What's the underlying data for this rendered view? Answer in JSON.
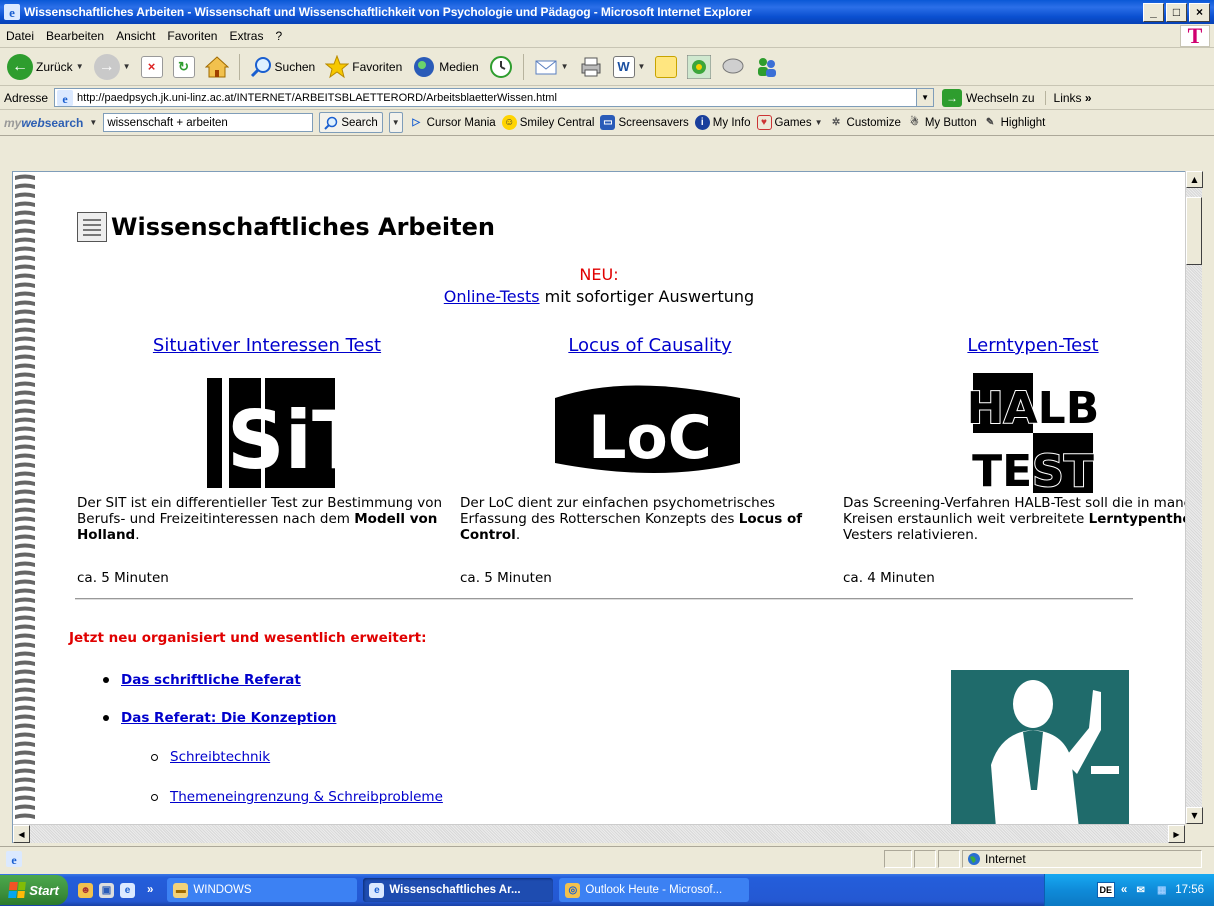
{
  "window": {
    "title": "Wissenschaftliches Arbeiten - Wissenschaft und Wissenschaftlichkeit von Psychologie und Pädagog - Microsoft Internet Explorer",
    "min": "_",
    "max": "□",
    "close": "×"
  },
  "menu": {
    "items": [
      "Datei",
      "Bearbeiten",
      "Ansicht",
      "Favoriten",
      "Extras",
      "?"
    ],
    "brand": "T"
  },
  "toolbar": {
    "back": "Zurück",
    "search": "Suchen",
    "favorites": "Favoriten",
    "media": "Medien"
  },
  "address": {
    "label": "Adresse",
    "url": "http://paedpsych.jk.uni-linz.ac.at/INTERNET/ARBEITSBLAETTERORD/ArbeitsblaetterWissen.html",
    "go": "Wechseln zu",
    "links": "Links"
  },
  "searchbar": {
    "brand_my": "my",
    "brand_web": "web",
    "brand_search": "search",
    "query": "wissenschaft + arbeiten",
    "button": "Search",
    "items": [
      "Cursor Mania",
      "Smiley Central",
      "Screensavers",
      "My Info",
      "Games",
      "Customize",
      "My Button",
      "Highlight"
    ]
  },
  "page": {
    "title": "Wissenschaftliches Arbeiten",
    "neu": "NEU:",
    "online_link": "Online-Tests",
    "online_rest": " mit sofortiger Auswertung",
    "tests": [
      {
        "title": "Situativer Interessen Test",
        "logo": "SiT",
        "desc_1": "Der SIT ist ein differentieller Test zur Bestimmung von Berufs- und Freizeitinteressen nach dem ",
        "desc_bold": "Modell von Holland",
        "desc_2": ".",
        "time": "ca. 5 Minuten"
      },
      {
        "title": "Locus of Causality",
        "logo": "LoC",
        "desc_1": "Der LoC dient zur einfachen psychometrisches Erfassung des Rotterschen Konzepts des ",
        "desc_bold": "Locus of Control",
        "desc_2": ".",
        "time": "ca. 5 Minuten"
      },
      {
        "title": "Lerntypen-Test",
        "logo_1": "HALB",
        "logo_2": "TEST",
        "desc_1": "Das Screening-Verfahren HALB-Test soll die in manchen Kreisen erstaunlich weit verbreitete ",
        "desc_bold": "Lerntypentheorie",
        "desc_2": " Vesters relativieren.",
        "time": "ca. 4 Minuten"
      }
    ],
    "red_heading": "Jetzt neu organisiert und wesentlich erweitert:",
    "list": [
      {
        "text": "Das schriftliche Referat",
        "level": 1
      },
      {
        "text": "Das Referat: Die Konzeption",
        "level": 1
      },
      {
        "text": "Schreibtechnik",
        "level": 2
      },
      {
        "text": "Themeneingrenzung & Schreibprobleme",
        "level": 2
      }
    ]
  },
  "status": {
    "zone": "Internet"
  },
  "taskbar": {
    "start": "Start",
    "chevron": "»",
    "folder": "WINDOWS",
    "ie_window": "Wissenschaftliches Ar...",
    "outlook": "Outlook Heute - Microsof...",
    "lang": "DE",
    "tray_chevron": "«",
    "clock": "17:56"
  },
  "colors": {
    "link": "#0000cc",
    "red": "#e00000",
    "titlebar": "#0a4fd0",
    "taskbar": "#245edb"
  }
}
